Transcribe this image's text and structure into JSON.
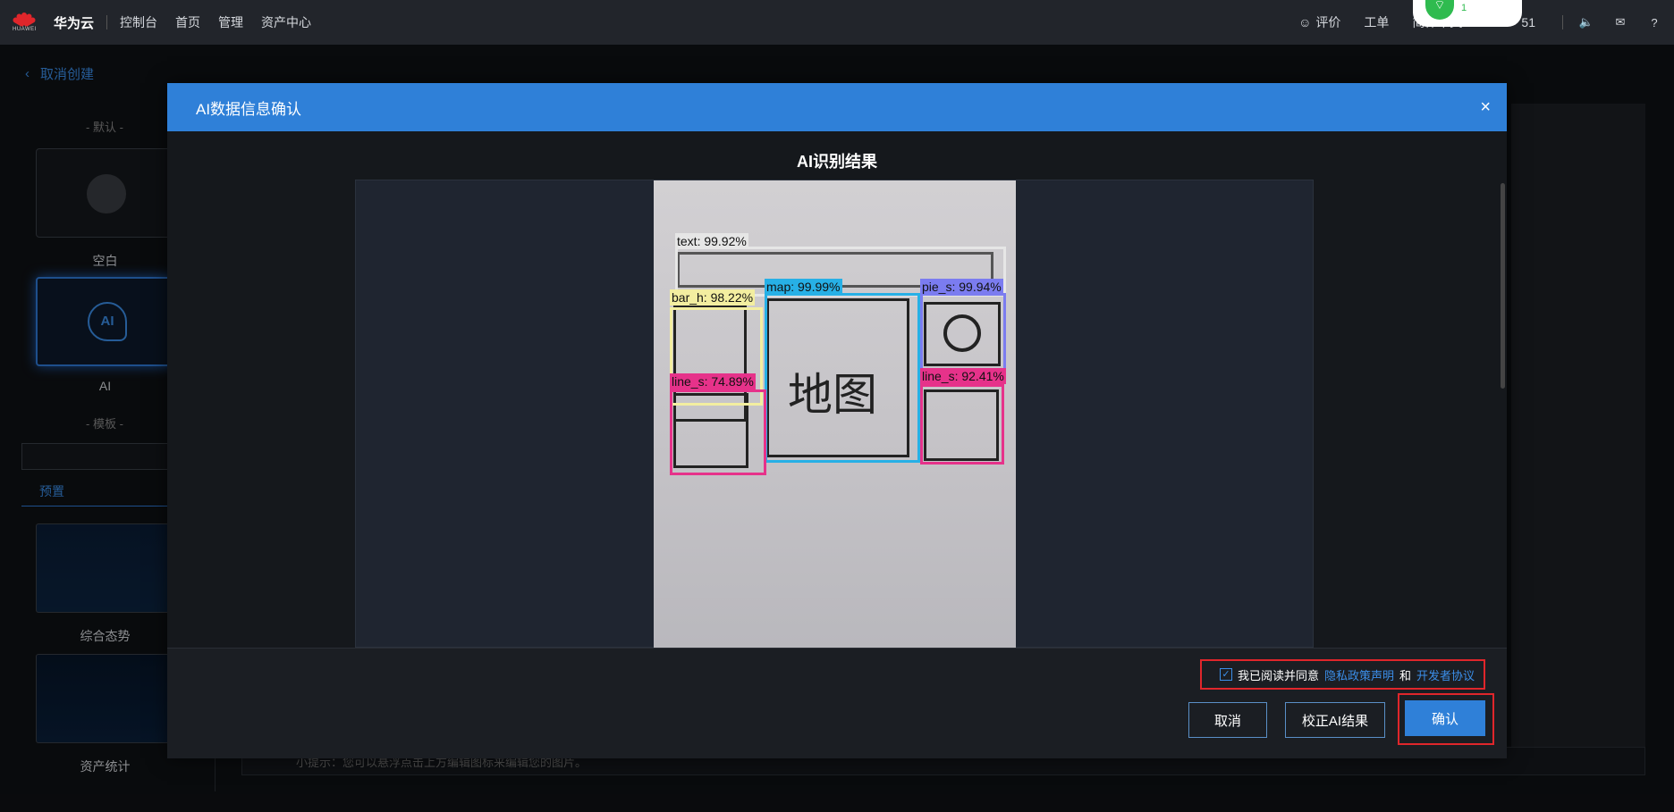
{
  "topbar": {
    "logo_text": "HUAWEI",
    "brand": "华为云",
    "nav": [
      "控制台",
      "首页",
      "管理",
      "资产中心"
    ],
    "right": {
      "feedback": "评价",
      "ticket": "工单",
      "language": "简体中文",
      "account": "51"
    },
    "wifi_badge": "1"
  },
  "back_link": "取消创建",
  "left_panel": {
    "default_title": "- 默认 -",
    "blank_label": "空白",
    "ai_label": "AI",
    "template_title": "- 模板 -",
    "tab_label": "预置",
    "templates": [
      "综合态势",
      "资产统计"
    ]
  },
  "hint": "小提示：您可以悬浮点击上方编辑图标来编辑您的图片。",
  "dialog": {
    "title": "AI数据信息确认",
    "result_title": "AI识别结果",
    "detections": [
      {
        "label": "text: 99.92%",
        "color": "#e6e6e6"
      },
      {
        "label": "map: 99.99%",
        "color": "#27b0e6"
      },
      {
        "label": "pie_s: 99.94%",
        "color": "#7b7cf0"
      },
      {
        "label": "bar_h: 98.22%",
        "color": "#f3eea0"
      },
      {
        "label": "line_s: 74.89%",
        "color": "#e6328a"
      },
      {
        "label": "line_s: 92.41%",
        "color": "#e6328a"
      }
    ],
    "map_text": "地图",
    "footer": {
      "agree_prefix": "我已阅读并同意",
      "privacy_link": "隐私政策声明",
      "and": "和",
      "dev_link": "开发者协议",
      "cancel": "取消",
      "fix": "校正AI结果",
      "confirm": "确认"
    }
  }
}
